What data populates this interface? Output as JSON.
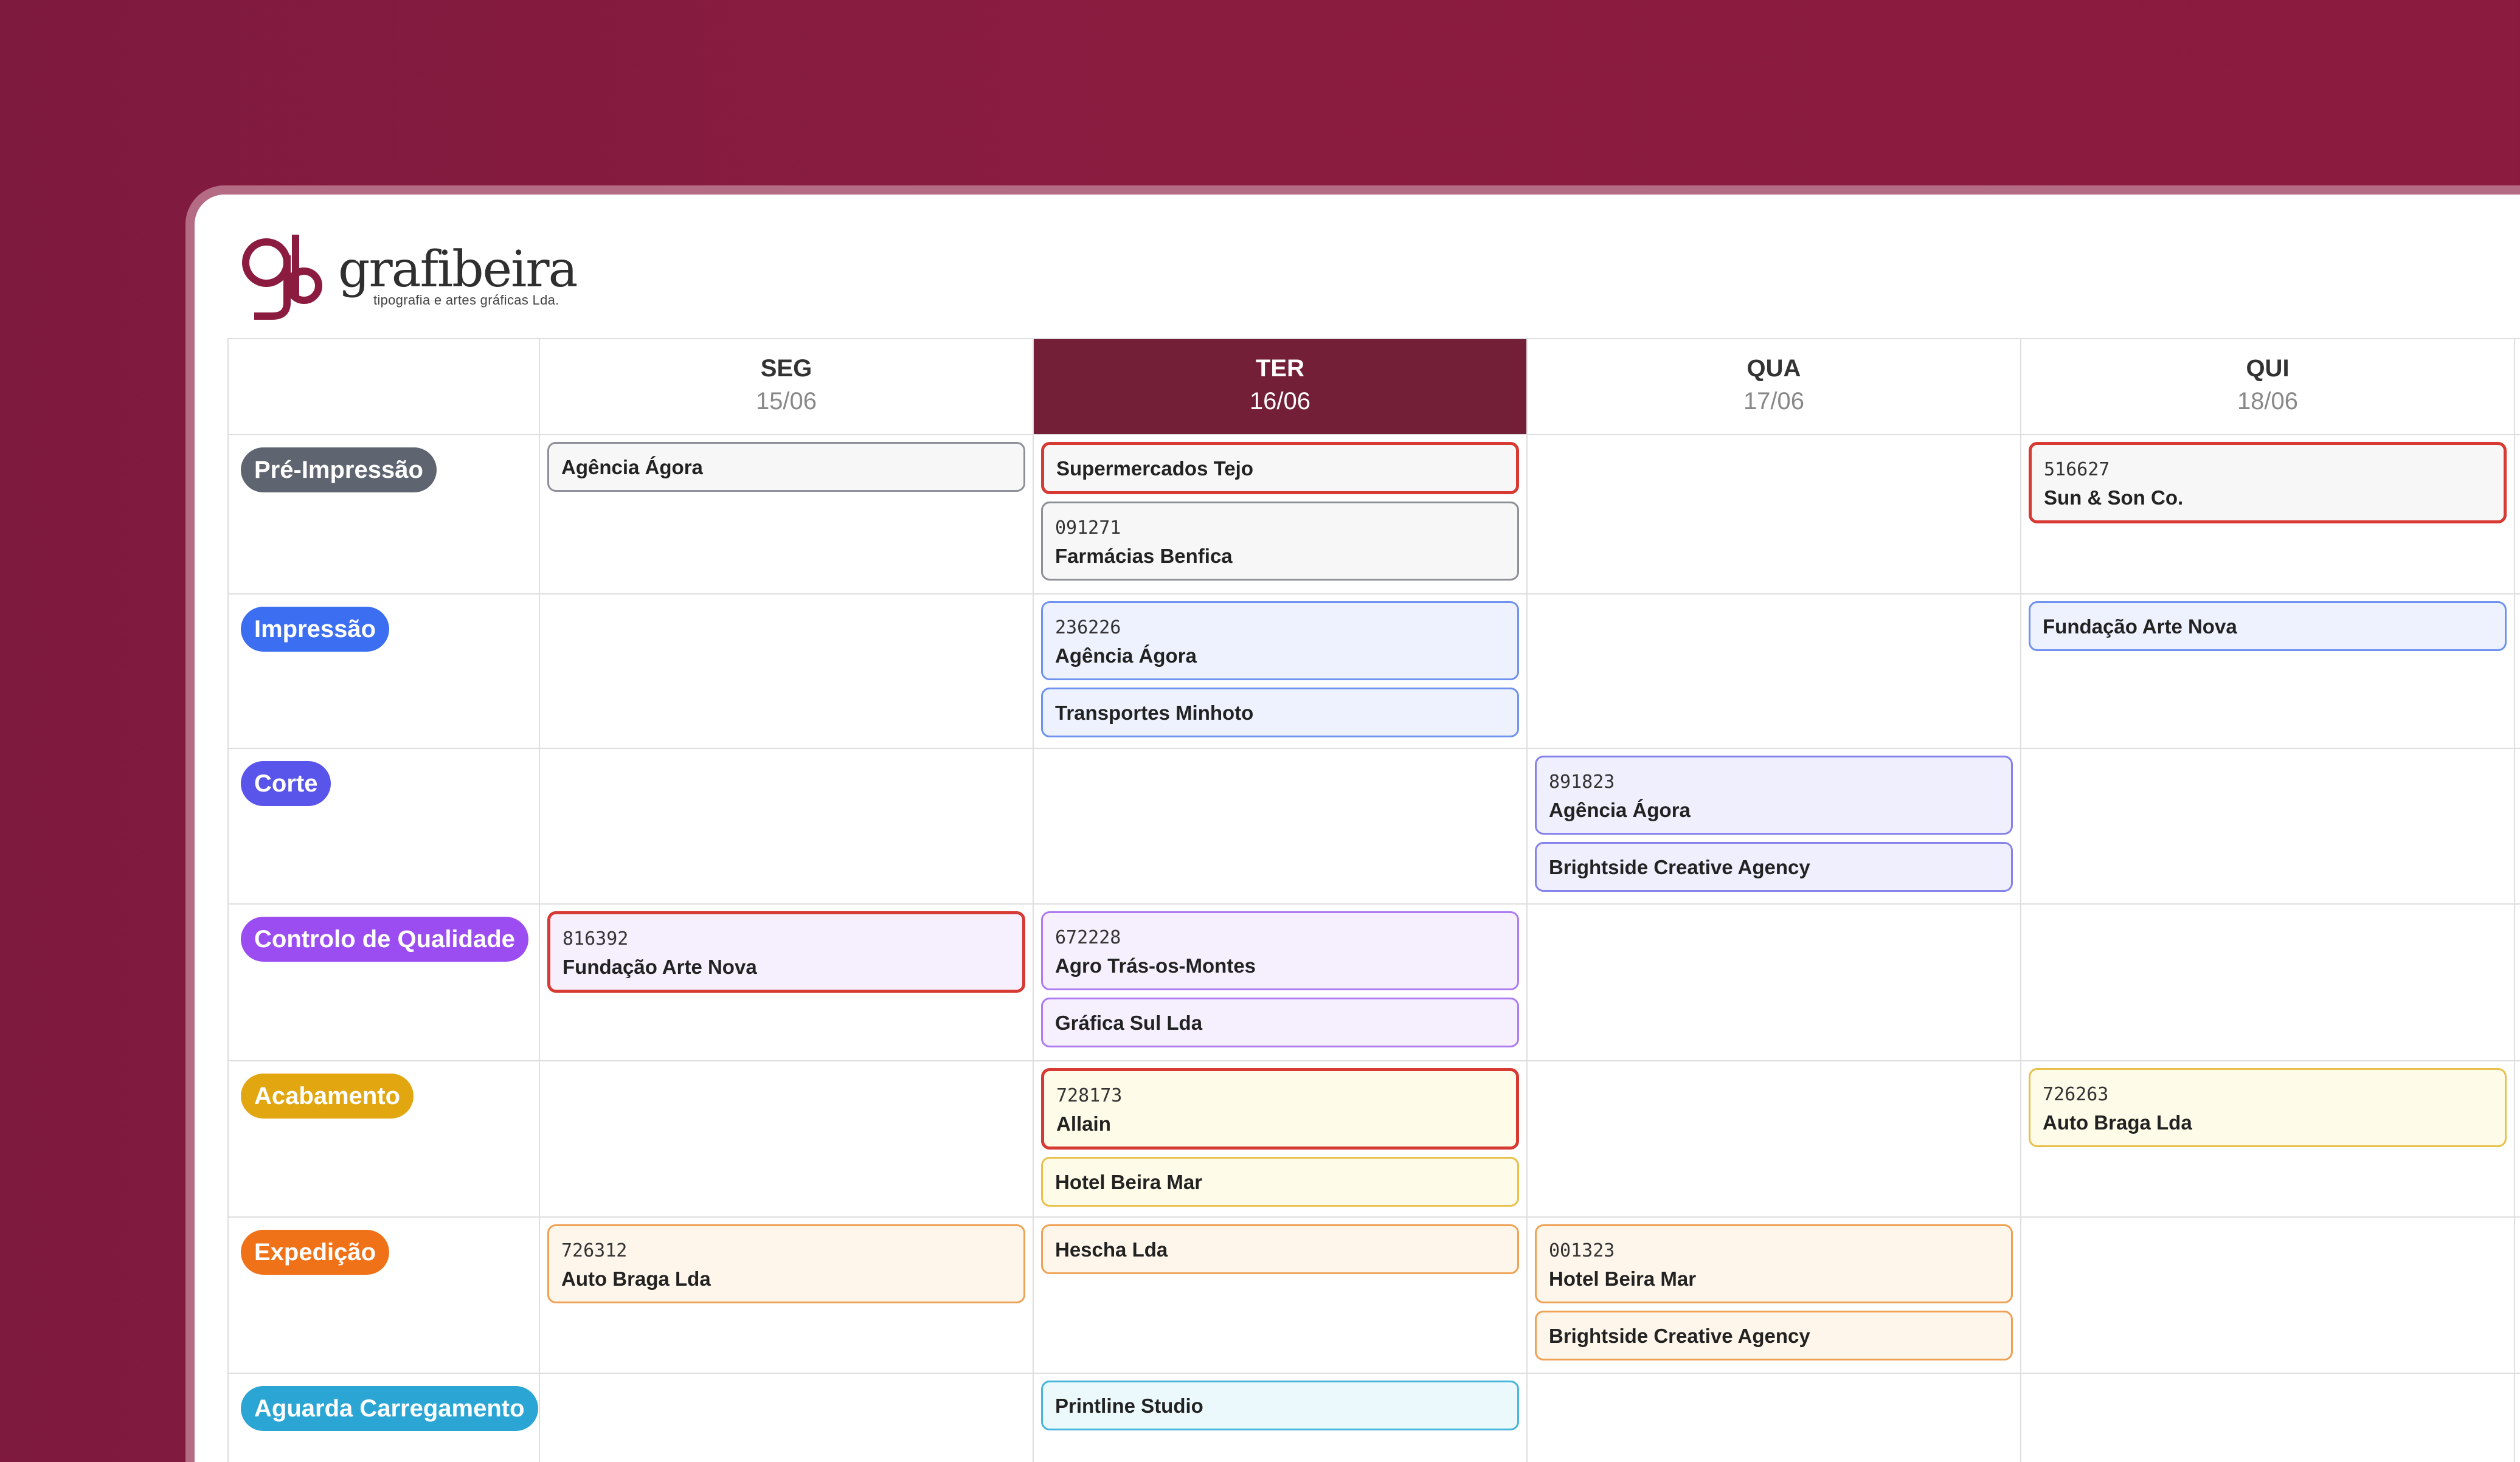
{
  "brand": {
    "name": "grafibeira",
    "tagline": "tipografia e artes gráficas Lda.",
    "logo_letters": "gb",
    "color": "#8b1c3f"
  },
  "days": [
    {
      "name": "SEG",
      "date": "15/06"
    },
    {
      "name": "TER",
      "date": "16/06",
      "active": true
    },
    {
      "name": "QUA",
      "date": "17/06"
    },
    {
      "name": "QUI",
      "date": "18/06"
    }
  ],
  "stages": [
    {
      "label": "Pré-Impressão",
      "color": "#5e6470"
    },
    {
      "label": "Impressão",
      "color": "#3b6ef0"
    },
    {
      "label": "Corte",
      "color": "#5a55ea"
    },
    {
      "label": "Controlo de Qualidade",
      "color": "#9b4df2"
    },
    {
      "label": "Acabamento",
      "color": "#e2a610"
    },
    {
      "label": "Expedição",
      "color": "#f07218"
    },
    {
      "label": "Aguarda Carregamento",
      "color": "#2ba6d4"
    }
  ],
  "jobs": {
    "pre_seg_1": {
      "client": "Agência Ágora"
    },
    "pre_ter_1": {
      "client": "Supermercados Tejo"
    },
    "pre_ter_2": {
      "code": "091271",
      "client": "Farmácias Benfica"
    },
    "pre_qui_1": {
      "code": "516627",
      "client": "Sun & Son Co."
    },
    "imp_ter_1": {
      "code": "236226",
      "client": "Agência Ágora"
    },
    "imp_ter_2": {
      "client": "Transportes Minhoto"
    },
    "imp_qui_1": {
      "client": "Fundação Arte Nova"
    },
    "cor_qua_1": {
      "code": "891823",
      "client": "Agência Ágora"
    },
    "cor_qua_2": {
      "client": "Brightside Creative Agency"
    },
    "cq_seg_1": {
      "code": "816392",
      "client": "Fundação Arte Nova"
    },
    "cq_ter_1": {
      "code": "672228",
      "client": "Agro Trás-os-Montes"
    },
    "cq_ter_2": {
      "client": "Gráfica Sul Lda"
    },
    "aca_ter_1": {
      "code": "728173",
      "client": "Allain"
    },
    "aca_ter_2": {
      "client": "Hotel Beira Mar"
    },
    "aca_qui_1": {
      "code": "726263",
      "client": "Auto Braga Lda"
    },
    "exp_seg_1": {
      "code": "726312",
      "client": "Auto Braga Lda"
    },
    "exp_ter_1": {
      "client": "Hescha Lda"
    },
    "exp_qua_1": {
      "code": "001323",
      "client": "Hotel Beira Mar"
    },
    "exp_qua_2": {
      "client": "Brightside Creative Agency"
    },
    "agu_ter_1": {
      "client": "Printline Studio"
    }
  },
  "card_styles": {
    "pre": {
      "bg": "#f7f7f8",
      "border": "#8d9098"
    },
    "imp": {
      "bg": "#edf2fe",
      "border": "#6f92ee"
    },
    "cor": {
      "bg": "#efeffd",
      "border": "#8582ec"
    },
    "cq": {
      "bg": "#f6f0fe",
      "border": "#ad7cef"
    },
    "aca": {
      "bg": "#fefbe8",
      "border": "#e8c04a"
    },
    "exp": {
      "bg": "#fef6ea",
      "border": "#eea256"
    },
    "agu": {
      "bg": "#ebf9fd",
      "border": "#46b6da"
    }
  }
}
